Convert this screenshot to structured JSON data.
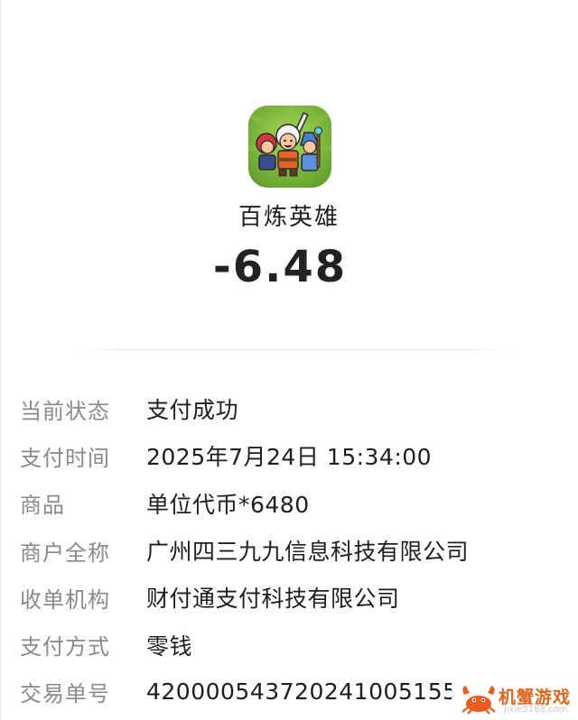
{
  "merchant": {
    "app_icon": "game-app-icon",
    "name": "百炼英雄",
    "amount": "-6.48"
  },
  "details": [
    {
      "label": "当前状态",
      "value": "支付成功"
    },
    {
      "label": "支付时间",
      "value": "2025年7月24日 15:34:00"
    },
    {
      "label": "商品",
      "value": "单位代币*6480"
    },
    {
      "label": "商户全称",
      "value": "广州四三九九信息科技有限公司"
    },
    {
      "label": "收单机构",
      "value": "财付通支付科技有限公司"
    },
    {
      "label": "支付方式",
      "value": "零钱"
    },
    {
      "label": "交易单号",
      "value": "420000543720241005155"
    }
  ],
  "watermark": {
    "logo": "crab-logo",
    "title": "机蟹游戏",
    "url": "jixie5188.com"
  }
}
